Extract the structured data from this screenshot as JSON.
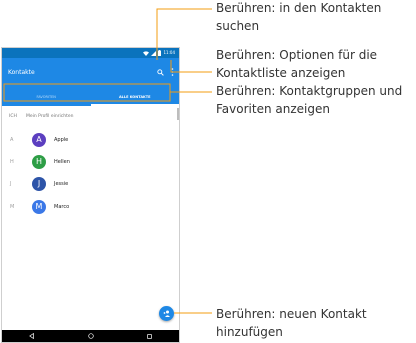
{
  "statusbar": {
    "time": "11:04"
  },
  "appbar": {
    "title": "Kontakte",
    "search_icon": "search-icon",
    "more_icon": "more-vert-icon"
  },
  "tabs": [
    {
      "label": "FAVORITEN",
      "active": false
    },
    {
      "label": "ALLE KONTAKTE",
      "active": true
    }
  ],
  "profile": {
    "letter": "ICH",
    "label": "Mein Profil einrichten"
  },
  "contacts": [
    {
      "section": "A",
      "initial": "A",
      "name": "Apple",
      "color": "#5c3fc0"
    },
    {
      "section": "H",
      "initial": "H",
      "name": "Hellen",
      "color": "#2e9e46"
    },
    {
      "section": "J",
      "initial": "J",
      "name": "Jessie",
      "color": "#2d54a8"
    },
    {
      "section": "M",
      "initial": "M",
      "name": "Marco",
      "color": "#3b78e7"
    }
  ],
  "fab_icon": "add-contact-icon",
  "navbar": {
    "back_icon": "back-icon",
    "home_icon": "home-icon",
    "recent_icon": "recent-apps-icon"
  },
  "callouts": {
    "search": {
      "line1": "Berühren: in den Kontakten",
      "line2": "suchen"
    },
    "options": {
      "line1": "Berühren: Optionen für die",
      "line2": "Kontaktliste anzeigen"
    },
    "groups": {
      "line1": "Berühren: Kontaktgruppen und",
      "line2": "Favoriten anzeigen"
    },
    "add": {
      "line1": "Berühren: neuen Kontakt",
      "line2": "hinzufügen"
    }
  },
  "colors": {
    "appbar": "#1e88e5",
    "statusbar": "#0a73bd",
    "callout_line": "#f39c12"
  }
}
